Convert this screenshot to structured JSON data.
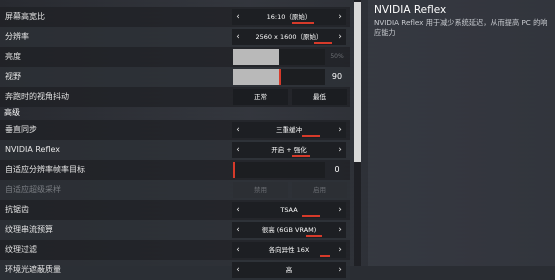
{
  "settings": {
    "aspect_ratio": {
      "label": "屏幕高宽比",
      "value": "16:10（原始）"
    },
    "resolution": {
      "label": "分辨率",
      "value": "2560 x 1600（原始）"
    },
    "brightness": {
      "label": "亮度",
      "value": "50%",
      "level": 0.5
    },
    "fov": {
      "label": "视野",
      "value": "90",
      "level": 0.5
    },
    "sprint_shake": {
      "label": "奔跑时的视角抖动",
      "options": [
        "正常",
        "最低"
      ]
    },
    "advanced_header": "高级",
    "vsync": {
      "label": "垂直同步",
      "value": "三重缓冲"
    },
    "reflex": {
      "label": "NVIDIA Reflex",
      "value": "开启 + 强化"
    },
    "adaptive_target": {
      "label": "自适应分辨率帧率目标",
      "value": "0"
    },
    "adaptive_supersample": {
      "label": "自适应超级采样",
      "options": [
        "禁用",
        "启用"
      ]
    },
    "antialiasing": {
      "label": "抗锯齿",
      "value": "TSAA"
    },
    "texture_budget": {
      "label": "纹理串流预算",
      "value": "很高 (6GB VRAM)"
    },
    "texture_filter": {
      "label": "纹理过滤",
      "value": "各向异性 16X"
    },
    "ambient_occlusion": {
      "label": "环境光遮蔽质量",
      "value": "高"
    }
  },
  "info": {
    "title": "NVIDIA Reflex",
    "description": "NVIDIA Reflex 用于减少系统延迟，从而提高 PC 的响应能力"
  },
  "icons": {
    "left": "chevron-left-icon",
    "right": "chevron-right-icon"
  },
  "colors": {
    "accent": "#d63a2a"
  }
}
